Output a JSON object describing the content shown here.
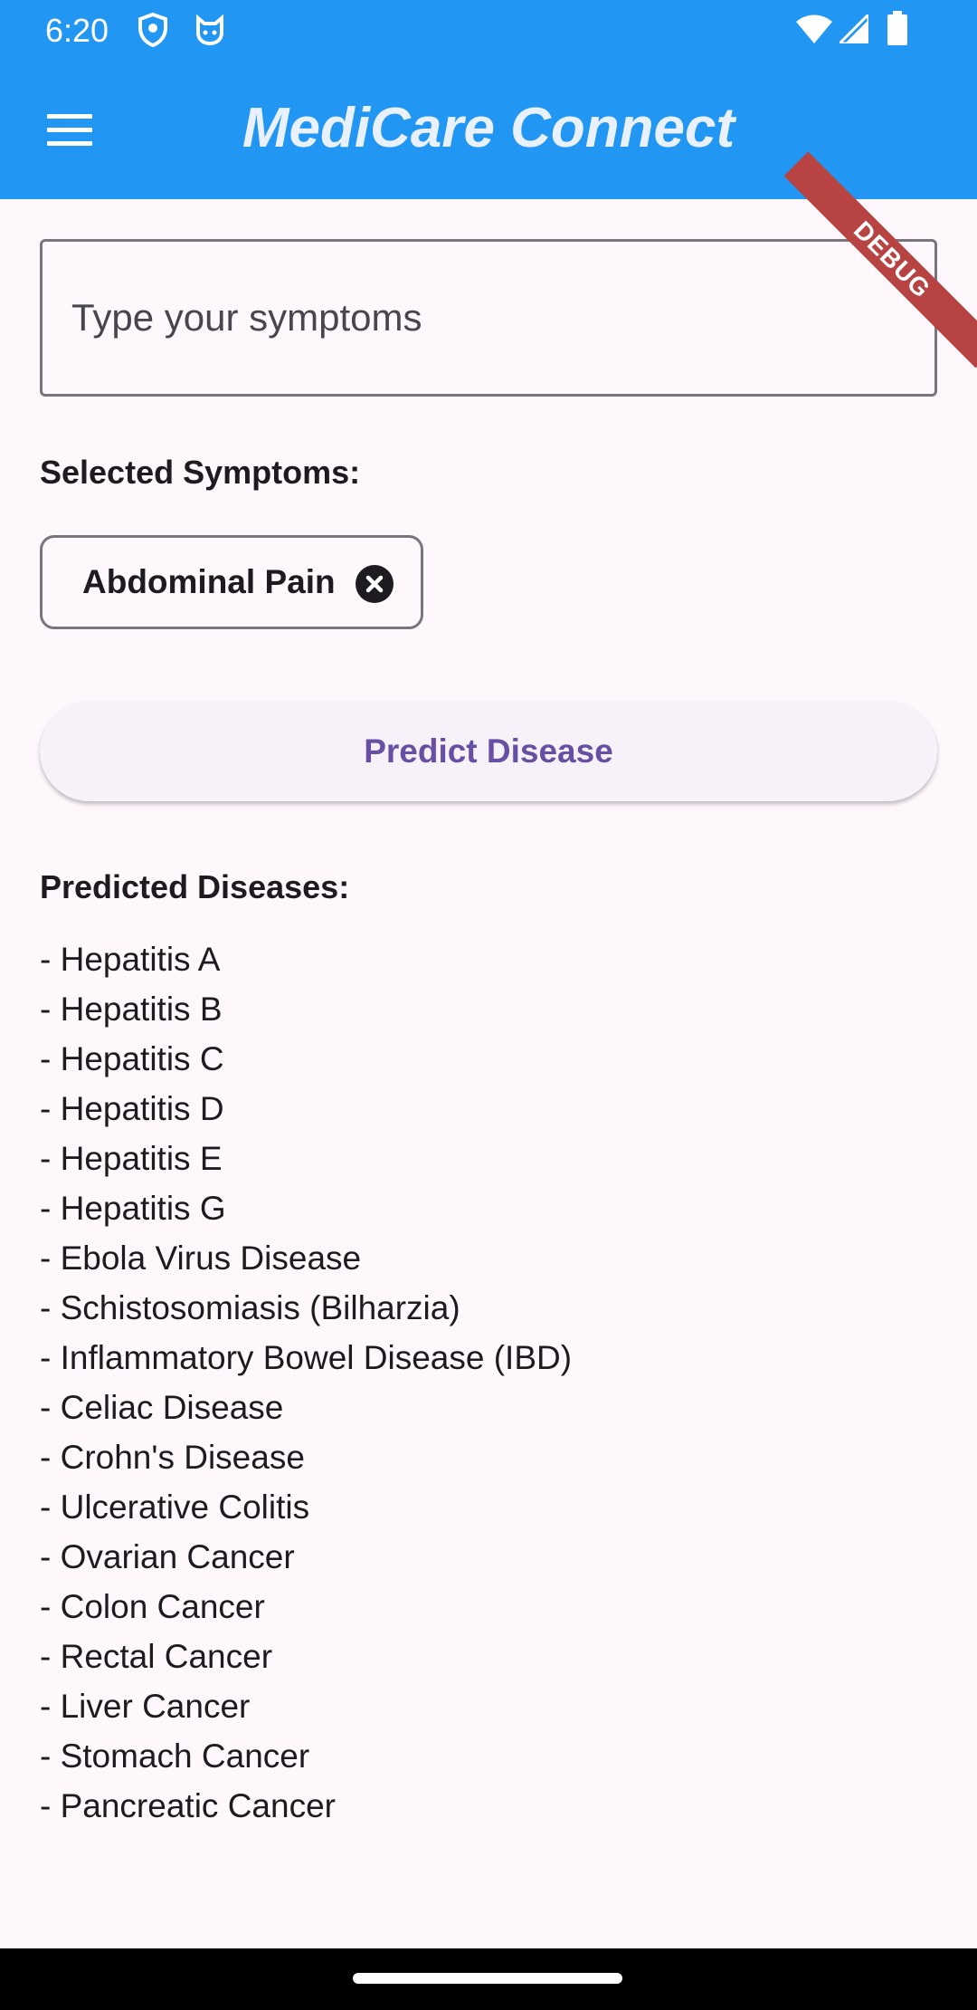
{
  "status_bar": {
    "time": "6:20",
    "left_icons": [
      "shield-icon",
      "cat-icon"
    ],
    "right_icons": [
      "wifi-icon",
      "signal-icon",
      "battery-icon"
    ]
  },
  "app_bar": {
    "title": "MediCare Connect",
    "menu_icon": "menu-icon",
    "color": "#2196f3"
  },
  "debug_banner": "DEBUG",
  "symptom_input": {
    "placeholder": "Type your symptoms",
    "value": ""
  },
  "selected_symptoms": {
    "label": "Selected Symptoms:",
    "chips": [
      {
        "label": "Abdominal Pain",
        "remove_icon": "close-circle-icon"
      }
    ]
  },
  "predict_button": {
    "label": "Predict Disease",
    "color": "#6750a4"
  },
  "predicted": {
    "label": "Predicted Diseases:",
    "items": [
      "- Hepatitis A",
      "- Hepatitis B",
      "- Hepatitis C",
      "- Hepatitis D",
      "- Hepatitis E",
      "- Hepatitis G",
      "- Ebola Virus Disease",
      "- Schistosomiasis (Bilharzia)",
      "- Inflammatory Bowel Disease (IBD)",
      "- Celiac Disease",
      "- Crohn's Disease",
      "- Ulcerative Colitis",
      "- Ovarian Cancer",
      "- Colon Cancer",
      "- Rectal Cancer",
      "- Liver Cancer",
      "- Stomach Cancer",
      "- Pancreatic Cancer"
    ]
  }
}
